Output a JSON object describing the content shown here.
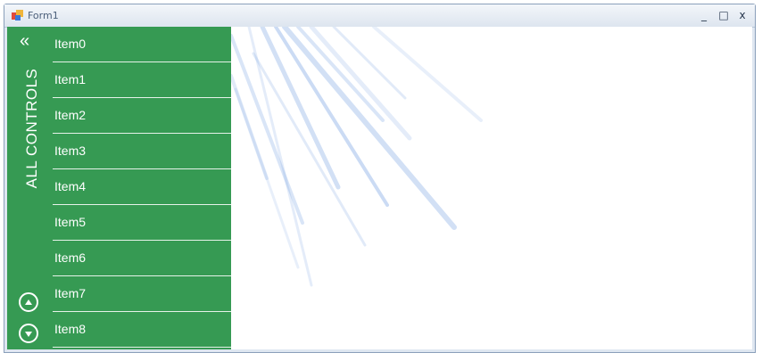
{
  "window": {
    "title": "Form1",
    "minimize_glyph": "_",
    "maximize_glyph": "□",
    "close_glyph": "x",
    "icon": "form-app-icon"
  },
  "nav": {
    "title": "ALL CONTROLS",
    "collapse_glyph": "«",
    "items": [
      {
        "label": "Item0"
      },
      {
        "label": "Item1"
      },
      {
        "label": "Item2"
      },
      {
        "label": "Item3"
      },
      {
        "label": "Item4"
      },
      {
        "label": "Item5"
      },
      {
        "label": "Item6"
      },
      {
        "label": "Item7"
      },
      {
        "label": "Item8"
      }
    ],
    "scroll_up_icon": "chevron-up-circle-icon",
    "scroll_down_icon": "chevron-down-circle-icon"
  },
  "colors": {
    "nav_background": "#369a53",
    "nav_text": "#ffffff",
    "ray_color": "#6c9be0",
    "titlebar": "#dde5ef"
  }
}
